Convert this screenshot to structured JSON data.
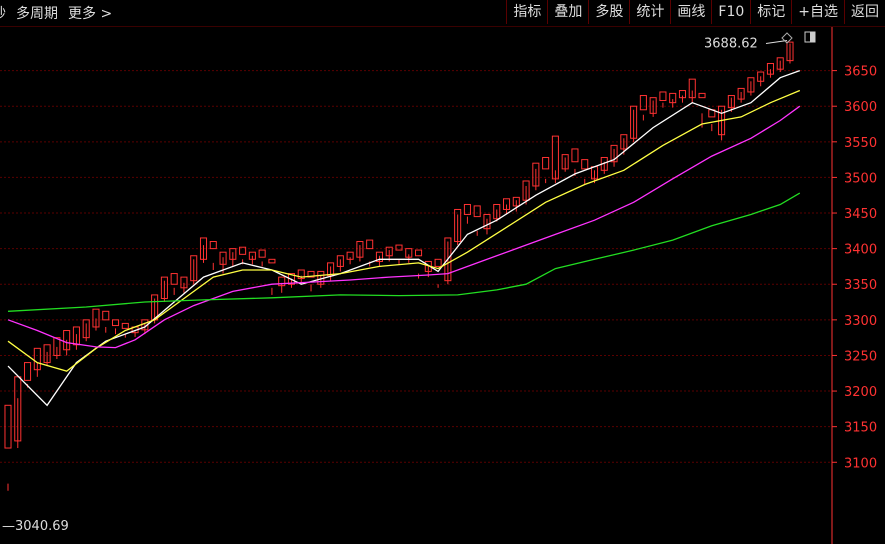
{
  "toolbar": {
    "back_glyph": "秒",
    "period": "多周期",
    "more": "更多 >",
    "buttons": [
      "指标",
      "叠加",
      "多股",
      "统计",
      "画线",
      "F10",
      "标记",
      "+自选",
      "返回"
    ]
  },
  "chart_data": {
    "type": "candlestick",
    "ylim": [
      3040,
      3700
    ],
    "yticks": [
      3100,
      3150,
      3200,
      3250,
      3300,
      3350,
      3400,
      3450,
      3500,
      3550,
      3600,
      3650
    ],
    "high_label": "3688.62",
    "low_label": "3040.69",
    "colors": {
      "up": "#ff3232",
      "down": "#54ffff",
      "ma5": "#ffffff",
      "ma10": "#ffff44",
      "ma20": "#ff33ff",
      "ma60": "#22dd22",
      "grid": "#5a0000",
      "axis": "#ff3232"
    },
    "candles": [
      [
        3120,
        3180,
        3070,
        3060
      ],
      [
        3130,
        3220,
        3190,
        3120
      ],
      [
        3215,
        3240,
        3210,
        3205
      ],
      [
        3230,
        3260,
        3240,
        3220
      ],
      [
        3240,
        3265,
        3255,
        3235
      ],
      [
        3250,
        3275,
        3262,
        3245
      ],
      [
        3258,
        3285,
        3272,
        3250
      ],
      [
        3265,
        3290,
        3280,
        3258
      ],
      [
        3275,
        3300,
        3295,
        3270
      ],
      [
        3290,
        3315,
        3302,
        3285
      ],
      [
        3300,
        3312,
        3290,
        3282
      ],
      [
        3292,
        3300,
        3288,
        3280
      ],
      [
        3288,
        3295,
        3280,
        3275
      ],
      [
        3282,
        3290,
        3284,
        3276
      ],
      [
        3286,
        3300,
        3296,
        3280
      ],
      [
        3300,
        3335,
        3330,
        3295
      ],
      [
        3330,
        3360,
        3355,
        3325
      ],
      [
        3350,
        3365,
        3345,
        3335
      ],
      [
        3345,
        3360,
        3352,
        3338
      ],
      [
        3355,
        3390,
        3385,
        3350
      ],
      [
        3385,
        3415,
        3405,
        3380
      ],
      [
        3400,
        3410,
        3380,
        3370
      ],
      [
        3378,
        3395,
        3388,
        3365
      ],
      [
        3385,
        3400,
        3395,
        3375
      ],
      [
        3392,
        3402,
        3385,
        3378
      ],
      [
        3385,
        3395,
        3390,
        3378
      ],
      [
        3388,
        3398,
        3382,
        3375
      ],
      [
        3380,
        3385,
        3345,
        3335
      ],
      [
        3348,
        3360,
        3352,
        3338
      ],
      [
        3350,
        3365,
        3358,
        3345
      ],
      [
        3358,
        3370,
        3362,
        3350
      ],
      [
        3360,
        3368,
        3350,
        3340
      ],
      [
        3350,
        3368,
        3362,
        3345
      ],
      [
        3362,
        3380,
        3375,
        3355
      ],
      [
        3375,
        3390,
        3385,
        3368
      ],
      [
        3385,
        3395,
        3388,
        3378
      ],
      [
        3388,
        3410,
        3405,
        3382
      ],
      [
        3400,
        3412,
        3382,
        3375
      ],
      [
        3382,
        3395,
        3390,
        3375
      ],
      [
        3390,
        3402,
        3398,
        3382
      ],
      [
        3398,
        3405,
        3385,
        3378
      ],
      [
        3388,
        3400,
        3392,
        3380
      ],
      [
        3390,
        3398,
        3365,
        3358
      ],
      [
        3368,
        3382,
        3376,
        3360
      ],
      [
        3375,
        3385,
        3350,
        3345
      ],
      [
        3355,
        3415,
        3410,
        3350
      ],
      [
        3410,
        3455,
        3448,
        3405
      ],
      [
        3448,
        3462,
        3445,
        3435
      ],
      [
        3445,
        3460,
        3425,
        3418
      ],
      [
        3428,
        3448,
        3442,
        3420
      ],
      [
        3442,
        3462,
        3455,
        3438
      ],
      [
        3455,
        3470,
        3462,
        3448
      ],
      [
        3460,
        3472,
        3468,
        3452
      ],
      [
        3468,
        3495,
        3488,
        3462
      ],
      [
        3488,
        3520,
        3512,
        3482
      ],
      [
        3512,
        3528,
        3498,
        3492
      ],
      [
        3498,
        3558,
        3510,
        3492
      ],
      [
        3512,
        3532,
        3528,
        3508
      ],
      [
        3522,
        3540,
        3512,
        3502
      ],
      [
        3512,
        3525,
        3498,
        3490
      ],
      [
        3498,
        3515,
        3510,
        3492
      ],
      [
        3510,
        3528,
        3522,
        3505
      ],
      [
        3522,
        3545,
        3540,
        3515
      ],
      [
        3540,
        3560,
        3555,
        3532
      ],
      [
        3555,
        3600,
        3595,
        3550
      ],
      [
        3595,
        3615,
        3588,
        3580
      ],
      [
        3590,
        3612,
        3608,
        3585
      ],
      [
        3608,
        3620,
        3605,
        3598
      ],
      [
        3605,
        3618,
        3610,
        3598
      ],
      [
        3612,
        3622,
        3615,
        3605
      ],
      [
        3612,
        3638,
        3622,
        3605
      ],
      [
        3612,
        3618,
        3590,
        3570
      ],
      [
        3585,
        3595,
        3575,
        3565
      ],
      [
        3560,
        3600,
        3595,
        3552
      ],
      [
        3598,
        3615,
        3612,
        3592
      ],
      [
        3610,
        3625,
        3620,
        3605
      ],
      [
        3620,
        3640,
        3635,
        3615
      ],
      [
        3635,
        3648,
        3642,
        3628
      ],
      [
        3645,
        3660,
        3652,
        3640
      ],
      [
        3652,
        3668,
        3664,
        3648
      ],
      [
        3664,
        3690,
        3688,
        3660
      ]
    ],
    "ma": [
      {
        "name": "ma5",
        "values": [
          [
            0,
            3235
          ],
          [
            4,
            3180
          ],
          [
            7,
            3240
          ],
          [
            10,
            3270
          ],
          [
            14,
            3290
          ],
          [
            17,
            3325
          ],
          [
            20,
            3360
          ],
          [
            24,
            3380
          ],
          [
            27,
            3370
          ],
          [
            30,
            3350
          ],
          [
            34,
            3365
          ],
          [
            38,
            3385
          ],
          [
            42,
            3385
          ],
          [
            44,
            3368
          ],
          [
            47,
            3420
          ],
          [
            50,
            3440
          ],
          [
            54,
            3475
          ],
          [
            58,
            3505
          ],
          [
            62,
            3525
          ],
          [
            66,
            3570
          ],
          [
            70,
            3605
          ],
          [
            73,
            3590
          ],
          [
            76,
            3605
          ],
          [
            79,
            3640
          ],
          [
            81,
            3650
          ]
        ]
      },
      {
        "name": "ma10",
        "values": [
          [
            0,
            3270
          ],
          [
            3,
            3240
          ],
          [
            6,
            3228
          ],
          [
            9,
            3260
          ],
          [
            12,
            3285
          ],
          [
            15,
            3300
          ],
          [
            18,
            3330
          ],
          [
            21,
            3360
          ],
          [
            24,
            3370
          ],
          [
            27,
            3370
          ],
          [
            30,
            3360
          ],
          [
            34,
            3365
          ],
          [
            38,
            3375
          ],
          [
            42,
            3380
          ],
          [
            44,
            3372
          ],
          [
            47,
            3395
          ],
          [
            51,
            3430
          ],
          [
            55,
            3465
          ],
          [
            59,
            3490
          ],
          [
            63,
            3510
          ],
          [
            67,
            3545
          ],
          [
            71,
            3575
          ],
          [
            75,
            3585
          ],
          [
            78,
            3605
          ],
          [
            81,
            3622
          ]
        ]
      },
      {
        "name": "ma20",
        "values": [
          [
            0,
            3300
          ],
          [
            3,
            3285
          ],
          [
            6,
            3268
          ],
          [
            9,
            3262
          ],
          [
            11,
            3261
          ],
          [
            13,
            3272
          ],
          [
            16,
            3300
          ],
          [
            19,
            3320
          ],
          [
            23,
            3340
          ],
          [
            27,
            3350
          ],
          [
            31,
            3353
          ],
          [
            35,
            3356
          ],
          [
            39,
            3360
          ],
          [
            43,
            3363
          ],
          [
            45,
            3365
          ],
          [
            48,
            3380
          ],
          [
            52,
            3400
          ],
          [
            56,
            3420
          ],
          [
            60,
            3440
          ],
          [
            64,
            3465
          ],
          [
            68,
            3498
          ],
          [
            72,
            3530
          ],
          [
            76,
            3555
          ],
          [
            79,
            3580
          ],
          [
            81,
            3600
          ]
        ]
      },
      {
        "name": "ma60",
        "values": [
          [
            0,
            3312
          ],
          [
            8,
            3318
          ],
          [
            14,
            3325
          ],
          [
            20,
            3328
          ],
          [
            27,
            3331
          ],
          [
            34,
            3335
          ],
          [
            40,
            3334
          ],
          [
            46,
            3335
          ],
          [
            50,
            3342
          ],
          [
            53,
            3350
          ],
          [
            56,
            3372
          ],
          [
            60,
            3385
          ],
          [
            64,
            3398
          ],
          [
            68,
            3412
          ],
          [
            72,
            3432
          ],
          [
            76,
            3448
          ],
          [
            79,
            3462
          ],
          [
            81,
            3478
          ]
        ]
      }
    ]
  }
}
